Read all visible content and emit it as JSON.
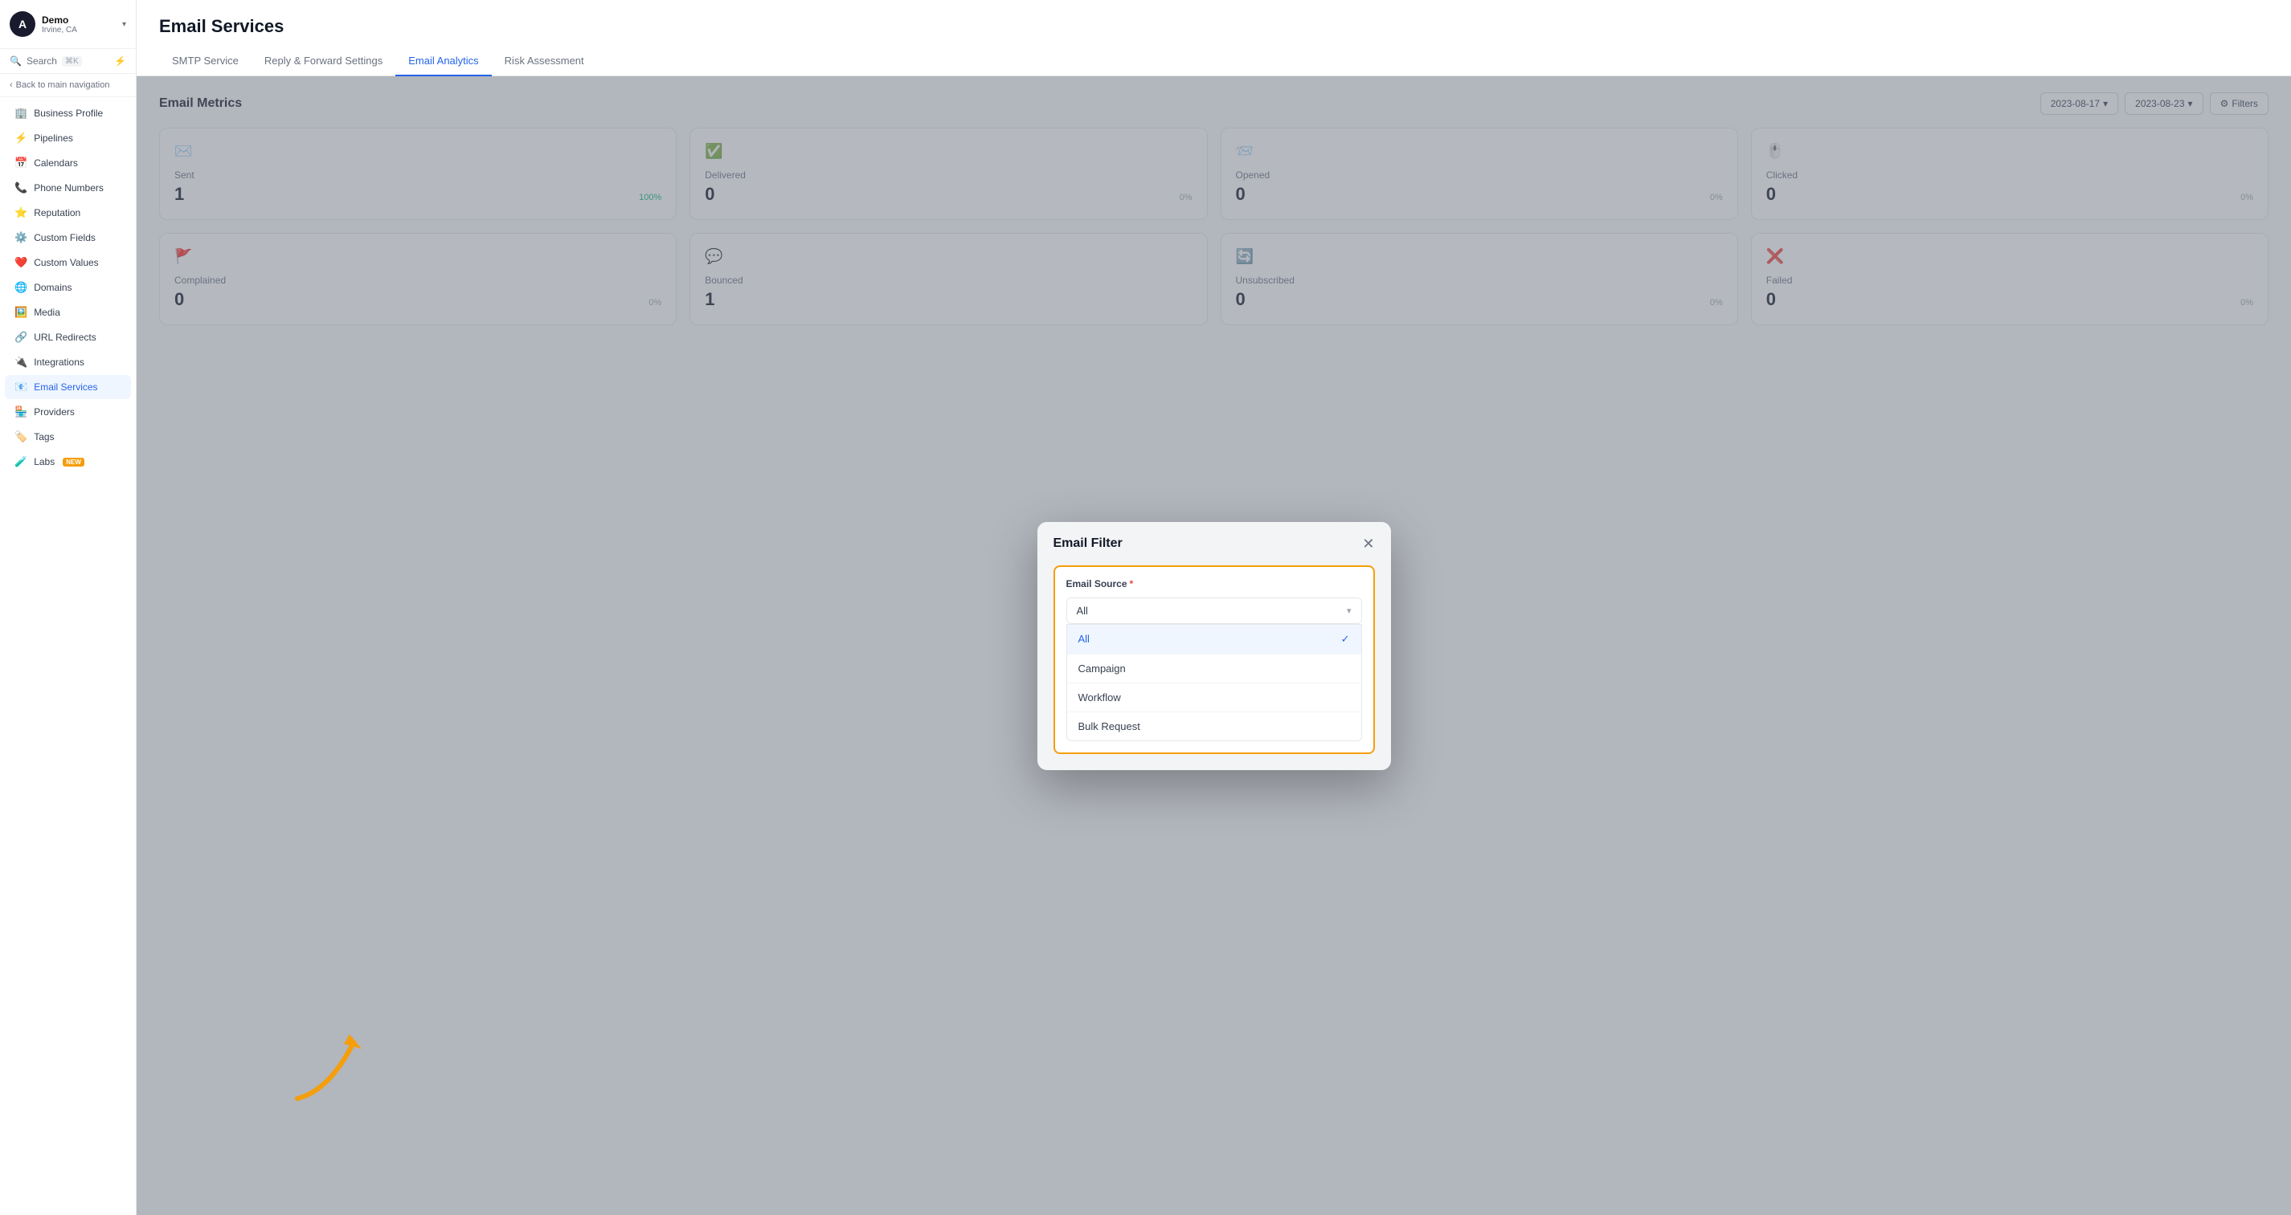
{
  "sidebar": {
    "user": {
      "name": "Demo",
      "location": "Irvine, CA",
      "avatar": "A"
    },
    "search": {
      "label": "Search",
      "shortcut": "⌘K"
    },
    "back_nav": "Back to main navigation",
    "items": [
      {
        "id": "business-profile",
        "label": "Business Profile",
        "icon": "🏢"
      },
      {
        "id": "pipelines",
        "label": "Pipelines",
        "icon": "⚡"
      },
      {
        "id": "calendars",
        "label": "Calendars",
        "icon": "📅"
      },
      {
        "id": "phone-numbers",
        "label": "Phone Numbers",
        "icon": "📞"
      },
      {
        "id": "reputation",
        "label": "Reputation",
        "icon": "⭐"
      },
      {
        "id": "custom-fields",
        "label": "Custom Fields",
        "icon": "⚙️"
      },
      {
        "id": "custom-values",
        "label": "Custom Values",
        "icon": "❤️"
      },
      {
        "id": "domains",
        "label": "Domains",
        "icon": "🌐"
      },
      {
        "id": "media",
        "label": "Media",
        "icon": "🖼️"
      },
      {
        "id": "url-redirects",
        "label": "URL Redirects",
        "icon": "🔗"
      },
      {
        "id": "integrations",
        "label": "Integrations",
        "icon": "🔌"
      },
      {
        "id": "email-services",
        "label": "Email Services",
        "icon": "📧",
        "active": true
      },
      {
        "id": "providers",
        "label": "Providers",
        "icon": "🏪"
      },
      {
        "id": "tags",
        "label": "Tags",
        "icon": "🏷️"
      },
      {
        "id": "labs",
        "label": "Labs",
        "icon": "🧪",
        "badge": "new"
      }
    ]
  },
  "page": {
    "title": "Email Services",
    "tabs": [
      {
        "id": "smtp",
        "label": "SMTP Service",
        "active": false
      },
      {
        "id": "reply-forward",
        "label": "Reply & Forward Settings",
        "active": false
      },
      {
        "id": "email-analytics",
        "label": "Email Analytics",
        "active": true
      },
      {
        "id": "risk-assessment",
        "label": "Risk Assessment",
        "active": false
      }
    ]
  },
  "metrics": {
    "title": "Email Metrics",
    "date_from": "2023-08-17",
    "date_to": "2023-08-23",
    "filters_label": "Filters",
    "cards": [
      {
        "id": "sent",
        "label": "Sent",
        "value": "1",
        "pct": "100%",
        "pct_class": "pct-green",
        "icon": "✉️"
      },
      {
        "id": "delivered",
        "label": "Delivered",
        "value": "0",
        "pct": "0%",
        "pct_class": "pct-gray",
        "icon": "✅"
      },
      {
        "id": "opened",
        "label": "Opened",
        "value": "0",
        "pct": "0%",
        "pct_class": "pct-gray",
        "icon": "📨"
      },
      {
        "id": "clicked",
        "label": "Clicked",
        "value": "0",
        "pct": "0%",
        "pct_class": "pct-gray",
        "icon": "🖱️"
      },
      {
        "id": "complained",
        "label": "Complained",
        "value": "0",
        "pct": "0%",
        "pct_class": "pct-gray",
        "icon": "🚩"
      },
      {
        "id": "bounced",
        "label": "Bounced",
        "value": "1",
        "pct": "",
        "pct_class": "pct-gray",
        "icon": "💬"
      },
      {
        "id": "unsubscribed",
        "label": "Unsubscribed",
        "value": "0",
        "pct": "0%",
        "pct_class": "pct-gray",
        "icon": "🔄"
      },
      {
        "id": "failed",
        "label": "Failed",
        "value": "0",
        "pct": "0%",
        "pct_class": "pct-gray",
        "icon": "❌"
      }
    ]
  },
  "modal": {
    "title": "Email Filter",
    "source_label": "Email Source",
    "required": "*",
    "selected_value": "All",
    "options": [
      {
        "id": "all",
        "label": "All",
        "selected": true
      },
      {
        "id": "campaign",
        "label": "Campaign",
        "selected": false
      },
      {
        "id": "workflow",
        "label": "Workflow",
        "selected": false
      },
      {
        "id": "bulk-request",
        "label": "Bulk Request",
        "selected": false
      }
    ]
  }
}
